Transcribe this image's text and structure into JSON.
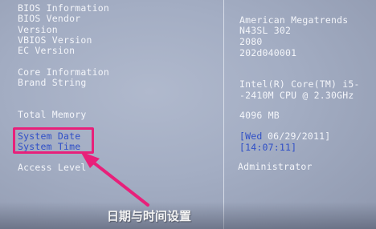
{
  "bios_info": {
    "heading": "BIOS Information",
    "vendor_label": "BIOS Vendor",
    "vendor_value": "American Megatrends",
    "version_label": "Version",
    "version_value": "N43SL 302",
    "vbios_label": "VBIOS Version",
    "vbios_value": "2080",
    "ec_label": "EC Version",
    "ec_value": "202d040001"
  },
  "core_info": {
    "heading": "Core Information",
    "brand_label": "Brand String",
    "brand_value_line1": "Intel(R) Core(TM) i5-",
    "brand_value_line2": "-2410M CPU @ 2.30GHz"
  },
  "memory": {
    "label": "Total Memory",
    "value": "4096 MB"
  },
  "system_date": {
    "label": "System Date",
    "day": "[Wed",
    "date": "06/29/2011]"
  },
  "system_time": {
    "label": "System Time",
    "value": "[14:07:11]"
  },
  "access": {
    "label": "Access Level",
    "value": "Administrator"
  },
  "annotation": {
    "caption": "日期与时间设置",
    "color": "#e8207a"
  }
}
